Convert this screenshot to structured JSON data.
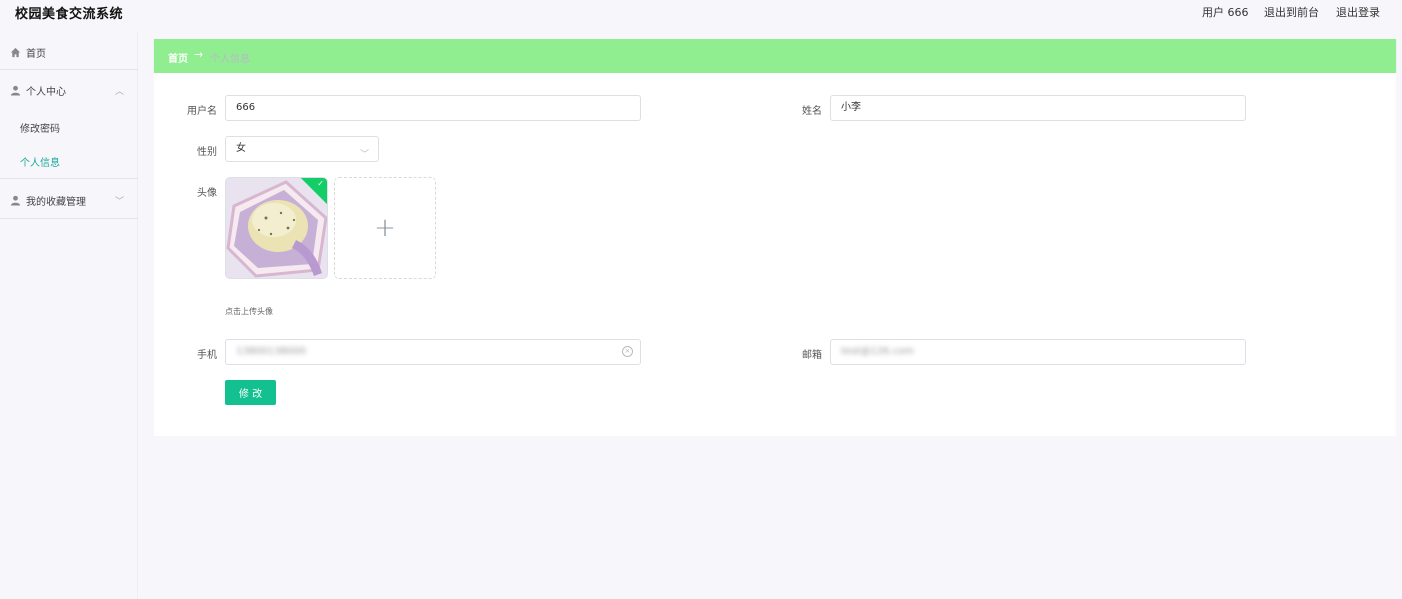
{
  "app": {
    "title": "校园美食交流系统"
  },
  "header": {
    "user_label": "用户 666",
    "front_link": "退出到前台",
    "logout_link": "退出登录"
  },
  "sidebar": {
    "home": "首页",
    "center": "个人中心",
    "change_password": "修改密码",
    "personal_info": "个人信息",
    "favorites": "我的收藏管理"
  },
  "breadcrumb": {
    "home": "首页",
    "current": "个人信息"
  },
  "form": {
    "username": {
      "label": "用户名",
      "value": "666"
    },
    "name": {
      "label": "姓名",
      "value": "小李"
    },
    "gender": {
      "label": "性别",
      "value": "女"
    },
    "avatar": {
      "label": "头像",
      "tip": "点击上传头像"
    },
    "phone": {
      "label": "手机",
      "value": "13800138000"
    },
    "email": {
      "label": "邮箱",
      "value": "test@126.com"
    },
    "submit": "修 改"
  },
  "colors": {
    "accent": "#13c08f",
    "breadcrumb_bg": "#90ee90",
    "active_menu": "#1aa89a"
  }
}
